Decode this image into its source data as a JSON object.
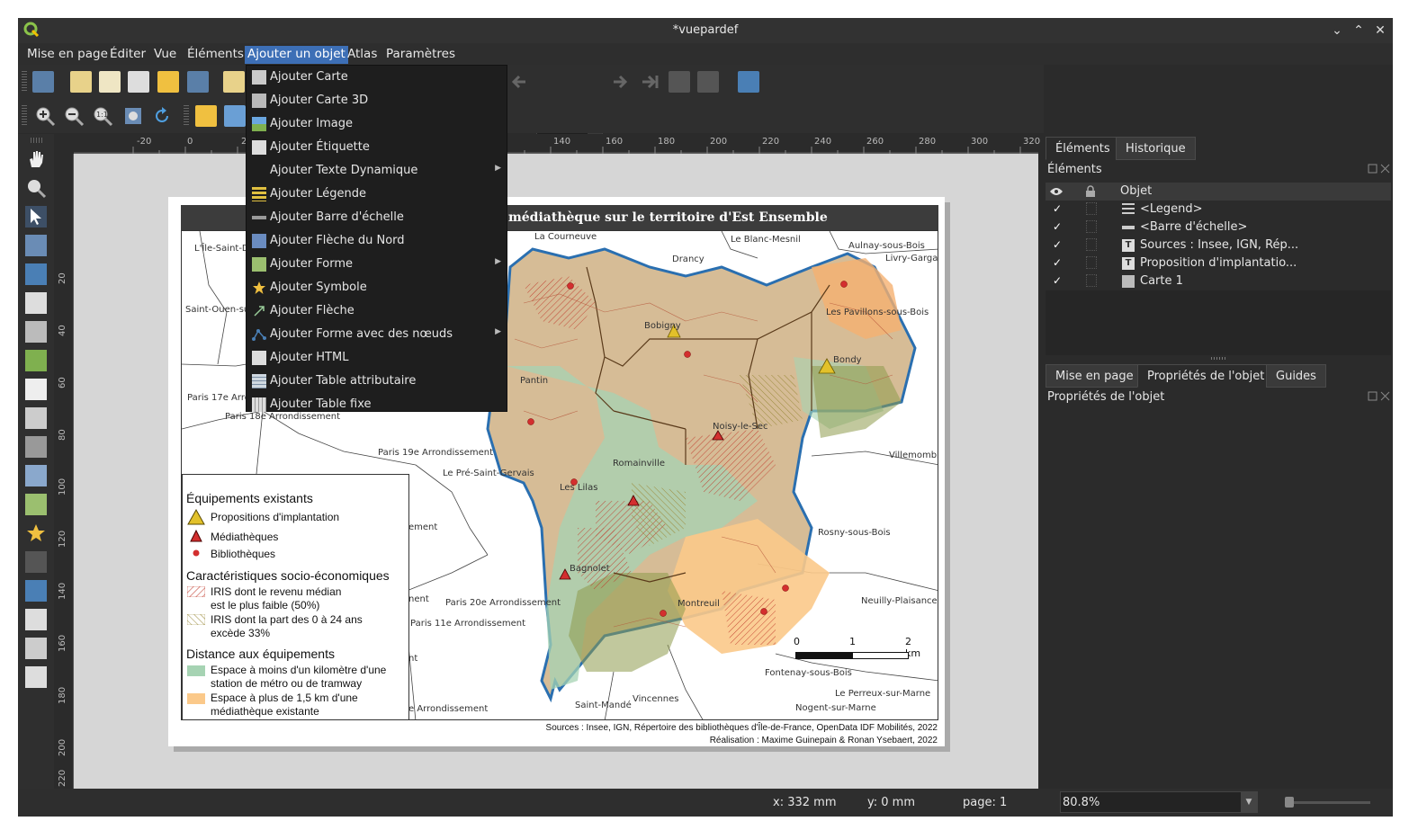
{
  "window": {
    "title": "*vuepardef",
    "controls": [
      "chevron-down-icon",
      "chevron-up-icon",
      "close-icon"
    ]
  },
  "menubar": {
    "items": [
      {
        "label": "Mise en page"
      },
      {
        "label": "Éditer"
      },
      {
        "label": "Vue"
      },
      {
        "label": "Éléments"
      },
      {
        "label": "Ajouter un objet",
        "active": true
      },
      {
        "label": "Atlas"
      },
      {
        "label": "Paramètres"
      }
    ]
  },
  "add_menu": {
    "items": [
      {
        "label": "Ajouter Carte",
        "icon": "map-icon"
      },
      {
        "label": "Ajouter Carte 3D",
        "icon": "map-3d-icon"
      },
      {
        "label": "Ajouter Image",
        "icon": "image-icon"
      },
      {
        "label": "Ajouter Étiquette",
        "icon": "label-icon"
      },
      {
        "label": "Ajouter Texte Dynamique",
        "icon": "",
        "submenu": true
      },
      {
        "label": "Ajouter Légende",
        "icon": "legend-icon"
      },
      {
        "label": "Ajouter Barre d'échelle",
        "icon": "scalebar-icon"
      },
      {
        "label": "Ajouter Flèche du Nord",
        "icon": "north-arrow-icon"
      },
      {
        "label": "Ajouter Forme",
        "icon": "shape-icon",
        "submenu": true
      },
      {
        "label": "Ajouter Symbole",
        "icon": "star-icon"
      },
      {
        "label": "Ajouter Flèche",
        "icon": "arrow-icon"
      },
      {
        "label": "Ajouter Forme avec des nœuds",
        "icon": "node-shape-icon",
        "submenu": true
      },
      {
        "label": "Ajouter HTML",
        "icon": "html-icon"
      },
      {
        "label": "Ajouter Table attributaire",
        "icon": "attribute-table-icon"
      },
      {
        "label": "Ajouter Table fixe",
        "icon": "fixed-table-icon"
      }
    ]
  },
  "toolbar": {
    "page_number": "1"
  },
  "ruler": {
    "top_ticks": [
      "-20",
      "0",
      "20",
      "140",
      "160",
      "180",
      "200",
      "220",
      "240",
      "260",
      "280",
      "300",
      "320"
    ],
    "left_ticks": [
      "20",
      "40",
      "60",
      "80",
      "100",
      "120",
      "140",
      "160",
      "180",
      "200",
      "220"
    ]
  },
  "layout": {
    "map_title": "ne médiathèque sur le territoire d'Est Ensemble",
    "place_labels": [
      "L'Île-Saint-D",
      "La Courneuve",
      "Le Blanc-Mesnil",
      "Aulnay-sous-Bois",
      "Livry-Gargan",
      "Drancy",
      "Saint-Ouen-su",
      "Bobigny",
      "Les Pavillons-sous-Bois",
      "Bondy",
      "Pantin",
      "Paris 17e Arro",
      "Paris 18e Arrondissement",
      "Noisy-le-Sec",
      "Paris 19e Arrondissement",
      "Villemomble",
      "Romainville",
      "Le Pré-Saint-Gervais",
      "Les Lilas",
      "ement",
      "Rosny-sous-Bois",
      "Bagnolet",
      "Paris 20e Arrondissement",
      "nent",
      "Montreuil",
      "Neuilly-Plaisance",
      "Paris 11e Arrondissement",
      "Fontenay-sous-Bois",
      "Vincennes",
      "Le Perreux-sur-Marne",
      "Saint-Mandé",
      "Nogent-sur-Marne",
      "e Arrondissement",
      "nt"
    ],
    "legend": {
      "h1": "Équipements existants",
      "i1": "Propositions d'implantation",
      "i2": "Médiathèques",
      "i3": "Bibliothèques",
      "h2": "Caractéristiques socio-économiques",
      "i4a": "IRIS dont le revenu médian",
      "i4b": "est le plus faible (50%)",
      "i5a": "IRIS dont la part des 0 à 24 ans",
      "i5b": "excède 33%",
      "h3": "Distance aux équipements",
      "i6a": "Espace à moins d'un kilomètre d'une",
      "i6b": "station de métro ou de tramway",
      "i7a": "Espace à plus de 1,5 km d'une",
      "i7b": "médiathèque existante"
    },
    "scale": {
      "l0": "0",
      "l1": "1",
      "l2": "2 km"
    },
    "sources_line1": "Sources : Insee, IGN, Répertoire des bibliothèques d'Île-de-France, OpenData IDF Mobilités, 2022",
    "sources_line2": "Réalisation : Maxime Guinepain & Ronan Ysebaert, 2022"
  },
  "right_panel": {
    "tabs_top": [
      {
        "label": "Éléments",
        "active": true
      },
      {
        "label": "Historique"
      }
    ],
    "elements_title": "Éléments",
    "column_header": "Objet",
    "elements": [
      {
        "label": "<Legend>",
        "icon": "legend-icon",
        "visible": "✓"
      },
      {
        "label": "<Barre d'échelle>",
        "icon": "scalebar-icon",
        "visible": "✓"
      },
      {
        "label": "Sources : Insee, IGN, Rép...",
        "icon": "text-icon",
        "visible": "✓"
      },
      {
        "label": "Proposition d'implantatio...",
        "icon": "text-icon",
        "visible": "✓"
      },
      {
        "label": "Carte 1",
        "icon": "map-icon",
        "visible": "✓"
      }
    ],
    "tabs_bottom": [
      {
        "label": "Mise en page"
      },
      {
        "label": "Propriétés de l'objet",
        "active": true
      },
      {
        "label": "Guides"
      }
    ],
    "properties_title": "Propriétés de l'objet"
  },
  "statusbar": {
    "x": "x: 332 mm",
    "y": "y: 0 mm",
    "page": "page: 1",
    "zoom": "80.8%"
  }
}
